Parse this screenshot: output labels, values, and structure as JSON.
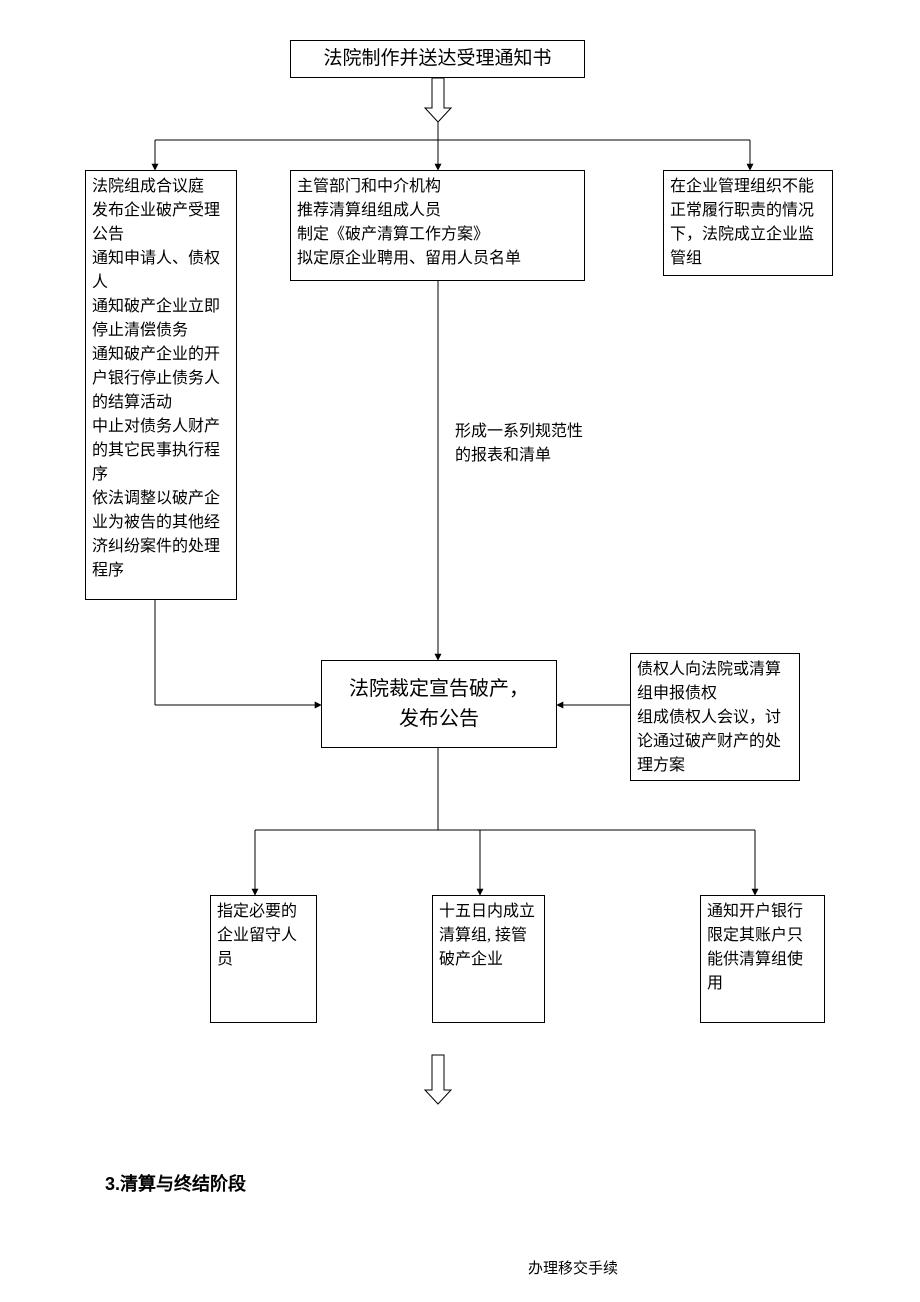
{
  "top": {
    "title": "法院制作并送达受理通知书"
  },
  "rowA": {
    "left": "法院组成合议庭\n发布企业破产受理公告\n通知申请人、债权人\n通知破产企业立即停止清偿债务\n通知破产企业的开户银行停止债务人的结算活动\n中止对债务人财产的其它民事执行程序\n依法调整以破产企业为被告的其他经济纠纷案件的处理程序",
    "mid": "主管部门和中介机构\n推荐清算组组成人员\n制定《破产清算工作方案》\n拟定原企业聘用、留用人员名单",
    "right": "在企业管理组织不能正常履行职责的情况下，法院成立企业监管组"
  },
  "midnote": "形成一系列规范性的报表和清单",
  "center": "法院裁定宣告破产，\n发布公告",
  "rightbox": "债权人向法院或清算组申报债权\n组成债权人会议，讨论通过破产财产的处理方案",
  "rowB": {
    "b1": "指定必要的企业留守人员",
    "b2": "十五日内成立清算组, 接管破产企业",
    "b3": "通知开户银行限定其账户只能供清算组使用"
  },
  "heading3": "3.清算与终结阶段",
  "footer_note": "办理移交手续"
}
